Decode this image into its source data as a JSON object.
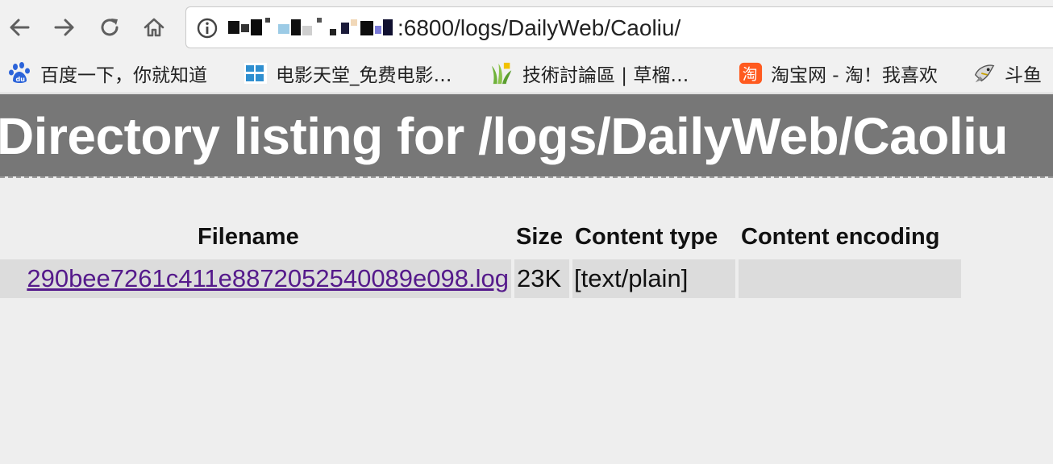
{
  "toolbar": {
    "url_visible": ":6800/logs/DailyWeb/Caoliu/"
  },
  "bookmarks": [
    {
      "icon": "baidu-paw-icon",
      "label": "百度一下，你就知道"
    },
    {
      "icon": "dianying-tiantang-icon",
      "label": "电影天堂_免费电影…"
    },
    {
      "icon": "caoliu-grass-icon",
      "label": "技術討論區 | 草榴…"
    },
    {
      "icon": "taobao-icon",
      "label": "淘宝网 - 淘！我喜欢"
    },
    {
      "icon": "douyu-fish-icon",
      "label": "斗鱼"
    }
  ],
  "page": {
    "title": "Directory listing for /logs/DailyWeb/Caoliu"
  },
  "listing": {
    "headers": {
      "filename": "Filename",
      "size": "Size",
      "content_type": "Content type",
      "content_encoding": "Content encoding"
    },
    "rows": [
      {
        "filename": "290bee7261c411e8872052540089e098.log",
        "size": "23K",
        "content_type": "[text/plain]",
        "content_encoding": ""
      }
    ]
  },
  "colors": {
    "header_bg": "#777777",
    "page_bg": "#eeeeee",
    "cell_bg": "#dcdcdc",
    "visited_link": "#551a8b"
  }
}
